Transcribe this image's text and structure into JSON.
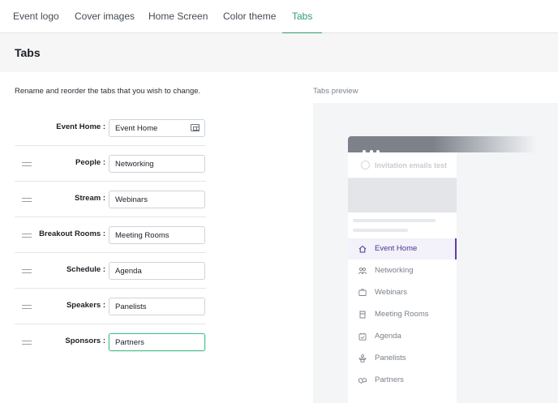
{
  "top_tabs": [
    {
      "label": "Event logo",
      "active": false
    },
    {
      "label": "Cover images",
      "active": false
    },
    {
      "label": "Home Screen",
      "active": false
    },
    {
      "label": "Color theme",
      "active": false
    },
    {
      "label": "Tabs",
      "active": true
    }
  ],
  "section": {
    "title": "Tabs",
    "intro": "Rename and reorder the tabs that you wish to change.",
    "preview_label": "Tabs preview"
  },
  "rows": [
    {
      "label": "Event Home :",
      "value": "Event Home",
      "draggable": false,
      "icon": "id-card-icon"
    },
    {
      "label": "People :",
      "value": "Networking",
      "draggable": true
    },
    {
      "label": "Stream :",
      "value": "Webinars",
      "draggable": true
    },
    {
      "label": "Breakout Rooms :",
      "value": "Meeting Rooms",
      "draggable": true
    },
    {
      "label": "Schedule :",
      "value": "Agenda",
      "draggable": true
    },
    {
      "label": "Speakers :",
      "value": "Panelists",
      "draggable": true
    },
    {
      "label": "Sponsors :",
      "value": "Partners",
      "draggable": true,
      "focused": true
    }
  ],
  "preview": {
    "event_name": "Invitation emails test",
    "nav": [
      {
        "label": "Event Home",
        "icon": "home-icon",
        "active": true
      },
      {
        "label": "Networking",
        "icon": "people-icon",
        "active": false
      },
      {
        "label": "Webinars",
        "icon": "video-icon",
        "active": false
      },
      {
        "label": "Meeting Rooms",
        "icon": "rooms-icon",
        "active": false
      },
      {
        "label": "Agenda",
        "icon": "calendar-icon",
        "active": false
      },
      {
        "label": "Panelists",
        "icon": "podium-icon",
        "active": false
      },
      {
        "label": "Partners",
        "icon": "handshake-icon",
        "active": false
      }
    ]
  },
  "colors": {
    "accent_green": "#2f9e6b",
    "focus_green": "#48c08a",
    "preview_active": "#5b3fa8"
  }
}
